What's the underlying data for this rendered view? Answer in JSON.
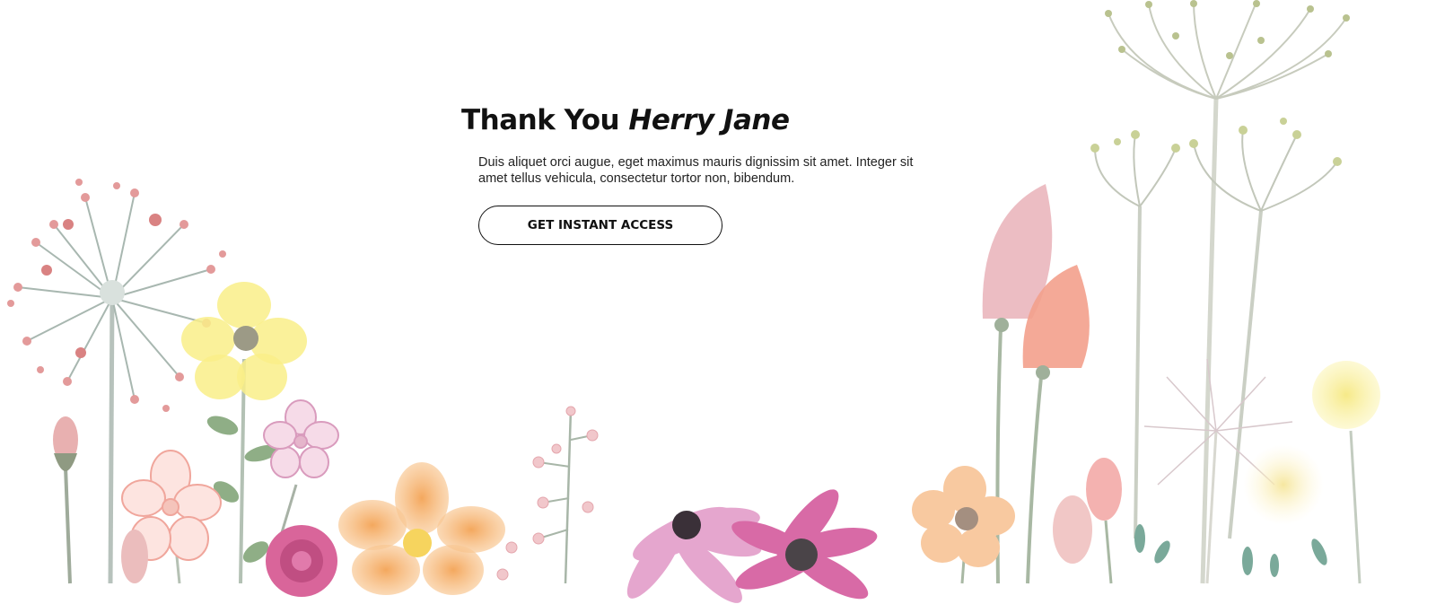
{
  "hero": {
    "title_prefix": "Thank You",
    "title_name": "Herry Jane",
    "description": "Duis aliquet orci augue, eget maximus mauris dignissim sit amet. Integer sit amet tellus vehicula, consectetur tortor non, bibendum.",
    "cta_label": "GET INSTANT ACCESS"
  },
  "colors": {
    "background": "#ffffff",
    "text": "#111111",
    "stem": "#a9b5a6",
    "petal_yellow": "#f7ea7a",
    "petal_orange": "#f6b77a",
    "petal_pink": "#e79bbd",
    "petal_magenta": "#d86aa6",
    "petal_coral": "#f3a08c"
  },
  "decor": {
    "illustration": "watercolor-wildflowers"
  }
}
